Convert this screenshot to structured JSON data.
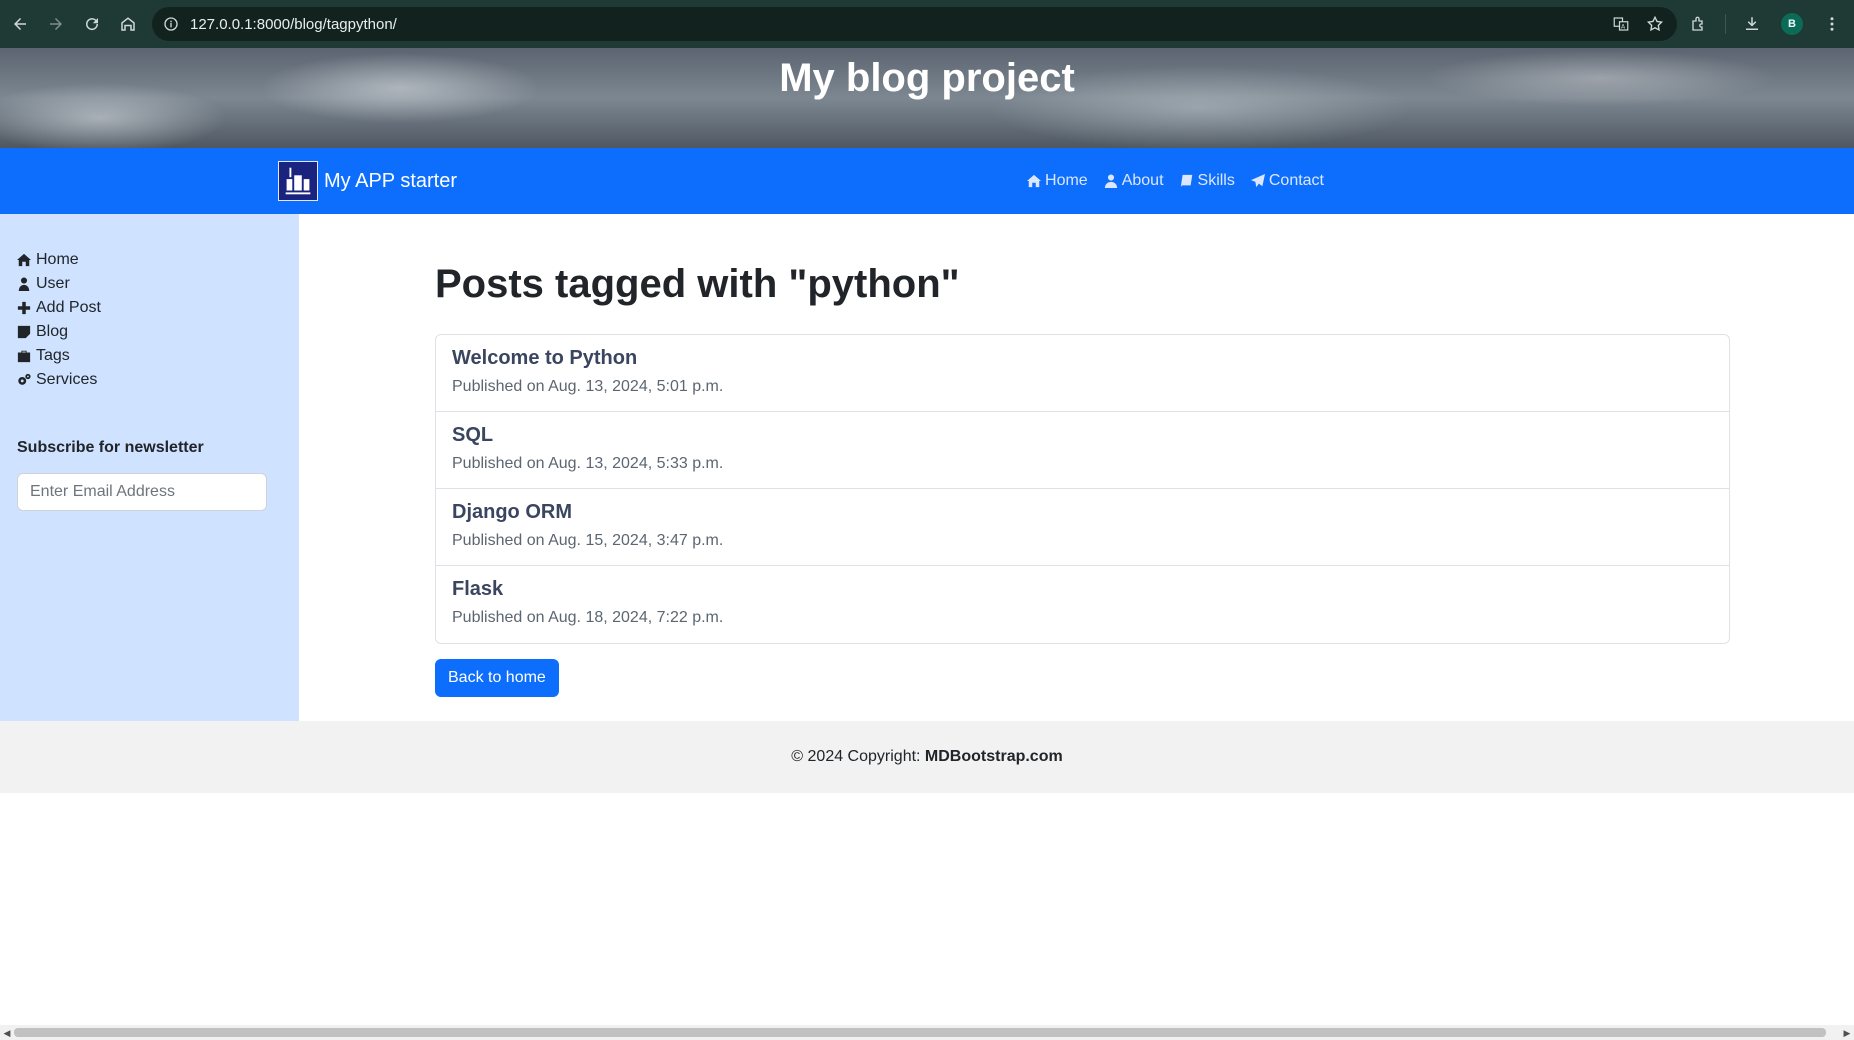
{
  "browser": {
    "url": "127.0.0.1:8000/blog/tagpython/",
    "profile_initial": "B"
  },
  "banner": {
    "title": "My blog project"
  },
  "navbar": {
    "brand": "My APP starter",
    "links": [
      {
        "label": "Home",
        "icon": "home-icon"
      },
      {
        "label": "About",
        "icon": "user-icon"
      },
      {
        "label": "Skills",
        "icon": "book-icon"
      },
      {
        "label": "Contact",
        "icon": "paper-plane-icon"
      }
    ]
  },
  "sidebar": {
    "items": [
      {
        "label": "Home",
        "icon": "home-icon"
      },
      {
        "label": "User",
        "icon": "user-icon"
      },
      {
        "label": "Add Post",
        "icon": "plus-icon"
      },
      {
        "label": "Blog",
        "icon": "sticky-note-icon"
      },
      {
        "label": "Tags",
        "icon": "briefcase-icon"
      },
      {
        "label": "Services",
        "icon": "gears-icon"
      }
    ],
    "newsletter_title": "Subscribe for newsletter",
    "email_placeholder": "Enter Email Address"
  },
  "main": {
    "title": "Posts tagged with \"python\"",
    "posts": [
      {
        "title": "Welcome to Python",
        "date": "Published on Aug. 13, 2024, 5:01 p.m."
      },
      {
        "title": "SQL",
        "date": "Published on Aug. 13, 2024, 5:33 p.m."
      },
      {
        "title": "Django ORM",
        "date": "Published on Aug. 15, 2024, 3:47 p.m."
      },
      {
        "title": "Flask",
        "date": "Published on Aug. 18, 2024, 7:22 p.m."
      }
    ],
    "back_button": "Back to home"
  },
  "footer": {
    "prefix": "© 2024 Copyright: ",
    "brand": "MDBootstrap.com"
  },
  "colors": {
    "navbar": "#0d6efd",
    "sidebar": "#cfe2ff",
    "button": "#0d6efd",
    "footer": "#f2f2f2"
  }
}
